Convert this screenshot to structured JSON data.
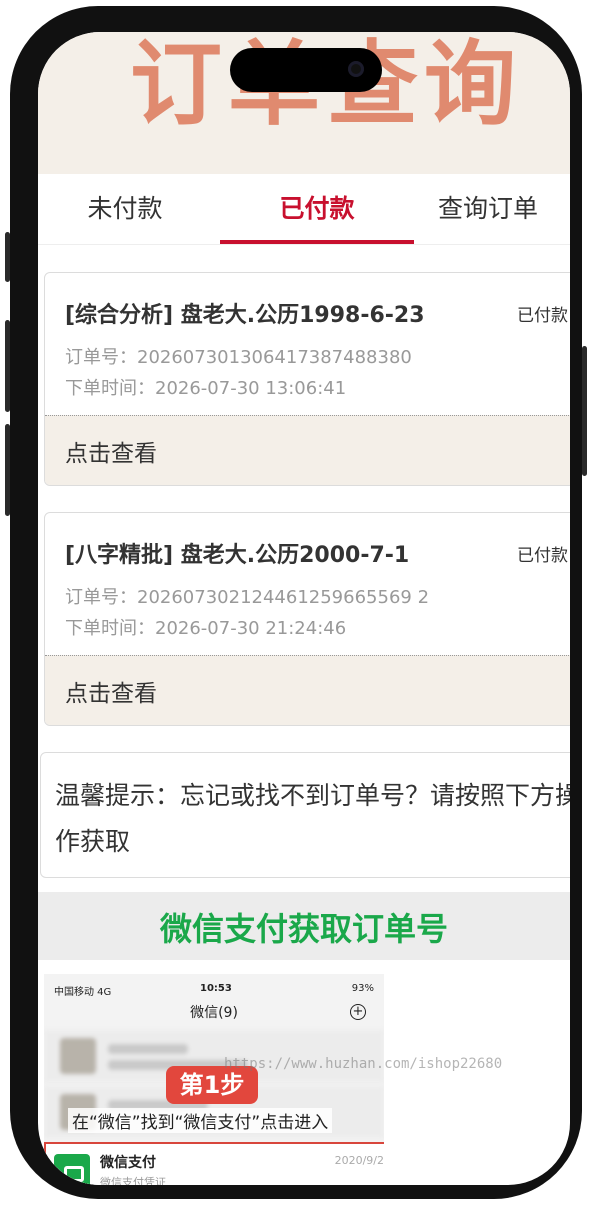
{
  "header": {
    "title": "订单查询"
  },
  "tabs": [
    {
      "label": "未付款",
      "active": false
    },
    {
      "label": "已付款",
      "active": true
    },
    {
      "label": "查询订单",
      "active": false
    }
  ],
  "orders": [
    {
      "title": "[综合分析] 盘老大.公历1998-6-23",
      "status": "已付款",
      "order_no": "订单号：202607301306417387488380",
      "order_time": "下单时间：2026-07-30 13:06:41",
      "action": "点击查看"
    },
    {
      "title": "[八字精批] 盘老大.公历2000-7-1",
      "status": "已付款",
      "order_no": "订单号：202607302124461259665569 2",
      "order_time": "下单时间：2026-07-30 21:24:46",
      "action": "点击查看"
    }
  ],
  "tip": {
    "text": "温馨提示：忘记或找不到订单号？请按照下方操作获取"
  },
  "wechat_section": {
    "banner": "微信支付获取订单号",
    "screenshot": {
      "carrier": "中国移动 4G",
      "time": "10:53",
      "battery": "93%",
      "title": "微信(9)",
      "step_badge": "第1步",
      "step_text": "在“微信”找到“微信支付”点击进入",
      "pay_name": "微信支付",
      "pay_sub": "微信支付凭证",
      "pay_date": "2020/9/2"
    },
    "watermark": "https://www.huzhan.com/ishop22680"
  },
  "colors": {
    "accent": "#c8102e",
    "header_bg": "#f4efe8",
    "title_color": "#e08a6f",
    "wechat_green": "#1aa84a"
  }
}
